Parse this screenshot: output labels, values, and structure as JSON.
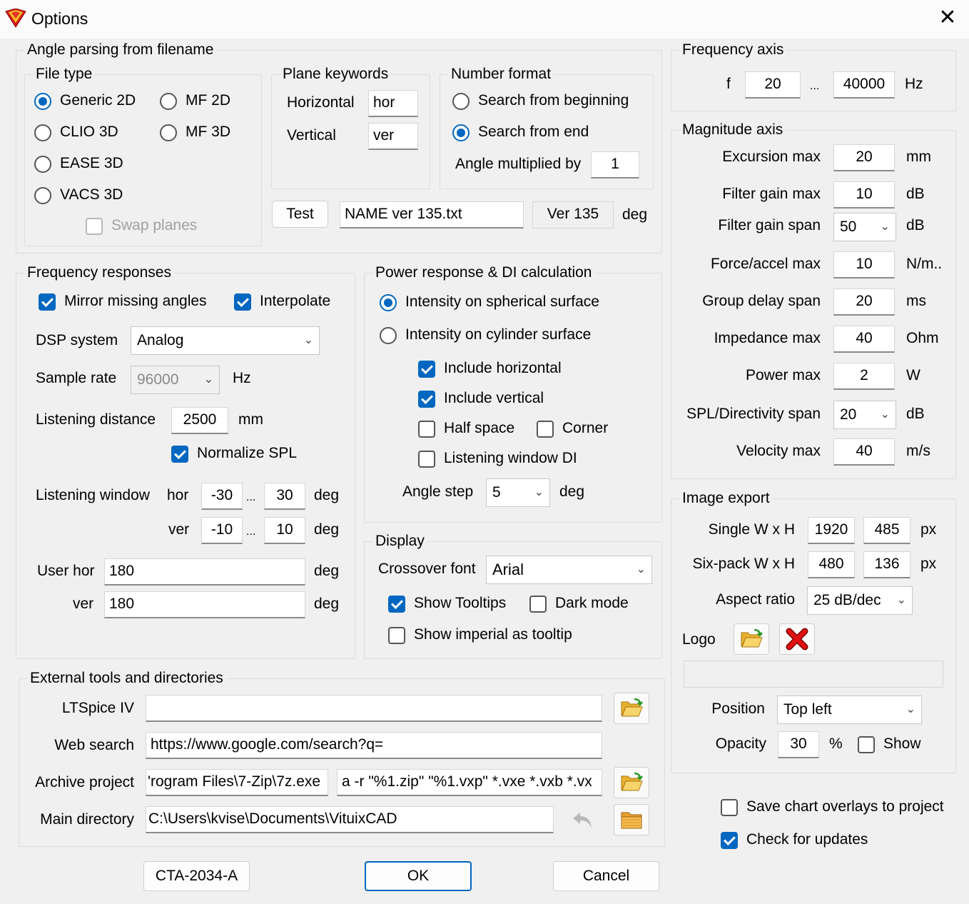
{
  "window": {
    "title": "Options",
    "close_symbol": "✕"
  },
  "angle_parsing": {
    "title": "Angle parsing from filename",
    "file_type": {
      "title": "File type",
      "options": [
        "Generic 2D",
        "MF 2D",
        "CLIO 3D",
        "MF 3D",
        "EASE 3D",
        "VACS 3D"
      ],
      "selected": "Generic 2D",
      "swap_planes": "Swap planes"
    },
    "plane_keywords": {
      "title": "Plane keywords",
      "horizontal_label": "Horizontal",
      "horizontal_value": "hor",
      "vertical_label": "Vertical",
      "vertical_value": "ver"
    },
    "number_format": {
      "title": "Number format",
      "search_beginning": "Search from beginning",
      "search_end": "Search from end",
      "multiplier_label": "Angle multiplied by",
      "multiplier_value": "1"
    },
    "test_button": "Test",
    "test_filename": "NAME ver 135.txt",
    "test_result": "Ver 135",
    "test_unit": "deg"
  },
  "frequency_responses": {
    "title": "Frequency responses",
    "mirror_missing": "Mirror missing angles",
    "interpolate": "Interpolate",
    "dsp_label": "DSP system",
    "dsp_value": "Analog",
    "sample_rate_label": "Sample rate",
    "sample_rate_value": "96000",
    "sample_rate_unit": "Hz",
    "listening_distance_label": "Listening distance",
    "listening_distance_value": "2500",
    "listening_distance_unit": "mm",
    "normalize_spl": "Normalize SPL",
    "listening_window_label": "Listening window",
    "hor_label": "hor",
    "hor_min": "-30",
    "hor_max": "30",
    "ver_label": "ver",
    "ver_min": "-10",
    "ver_max": "10",
    "ellipsis": "...",
    "deg": "deg",
    "user_hor_label": "User hor",
    "user_hor_value": "180",
    "user_ver_label": "ver",
    "user_ver_value": "180"
  },
  "power_response": {
    "title": "Power response & DI calculation",
    "spherical": "Intensity on spherical surface",
    "cylinder": "Intensity on cylinder surface",
    "include_horizontal": "Include horizontal",
    "include_vertical": "Include vertical",
    "half_space": "Half space",
    "corner": "Corner",
    "listening_window_di": "Listening window DI",
    "angle_step_label": "Angle step",
    "angle_step_value": "5",
    "angle_step_unit": "deg"
  },
  "display": {
    "title": "Display",
    "crossover_font_label": "Crossover font",
    "crossover_font_value": "Arial",
    "show_tooltips": "Show Tooltips",
    "dark_mode": "Dark mode",
    "show_imperial": "Show imperial as tooltip"
  },
  "external_tools": {
    "title": "External tools and directories",
    "ltspice_label": "LTSpice IV",
    "ltspice_value": "",
    "web_search_label": "Web search",
    "web_search_value": "https://www.google.com/search?q=",
    "archive_label": "Archive project",
    "archive_exe": "'rogram Files\\7-Zip\\7z.exe",
    "archive_args": "a -r \"%1.zip\" \"%1.vxp\" *.vxe *.vxb *.vx",
    "main_dir_label": "Main directory",
    "main_dir_value": "C:\\Users\\kvise\\Documents\\VituixCAD"
  },
  "frequency_axis": {
    "title": "Frequency axis",
    "f_label": "f",
    "min": "20",
    "ellipsis": "...",
    "max": "40000",
    "unit": "Hz"
  },
  "magnitude_axis": {
    "title": "Magnitude axis",
    "rows": [
      {
        "label": "Excursion max",
        "value": "20",
        "unit": "mm"
      },
      {
        "label": "Filter gain max",
        "value": "10",
        "unit": "dB"
      },
      {
        "label": "Filter gain span",
        "value": "50",
        "unit": "dB"
      },
      {
        "label": "Force/accel max",
        "value": "10",
        "unit": "N/m.."
      },
      {
        "label": "Group delay span",
        "value": "20",
        "unit": "ms"
      },
      {
        "label": "Impedance max",
        "value": "40",
        "unit": "Ohm"
      },
      {
        "label": "Power max",
        "value": "2",
        "unit": "W"
      },
      {
        "label": "SPL/Directivity span",
        "value": "20",
        "unit": "dB"
      },
      {
        "label": "Velocity max",
        "value": "40",
        "unit": "m/s"
      }
    ]
  },
  "image_export": {
    "title": "Image export",
    "single_label": "Single W x H",
    "single_w": "1920",
    "single_h": "485",
    "sixpack_label": "Six-pack W x H",
    "sixpack_w": "480",
    "sixpack_h": "136",
    "px": "px",
    "aspect_label": "Aspect ratio",
    "aspect_value": "25 dB/dec",
    "logo_label": "Logo",
    "logo_path": "",
    "position_label": "Position",
    "position_value": "Top left",
    "opacity_label": "Opacity",
    "opacity_value": "30",
    "opacity_unit": "%",
    "show": "Show"
  },
  "misc": {
    "save_overlays": "Save chart overlays to project",
    "check_updates": "Check for updates"
  },
  "buttons": {
    "cta": "CTA-2034-A",
    "ok": "OK",
    "cancel": "Cancel"
  },
  "colors": {
    "accent": "#0067c0",
    "delete_red": "#e01010",
    "folder_yellow": "#f4c542"
  }
}
